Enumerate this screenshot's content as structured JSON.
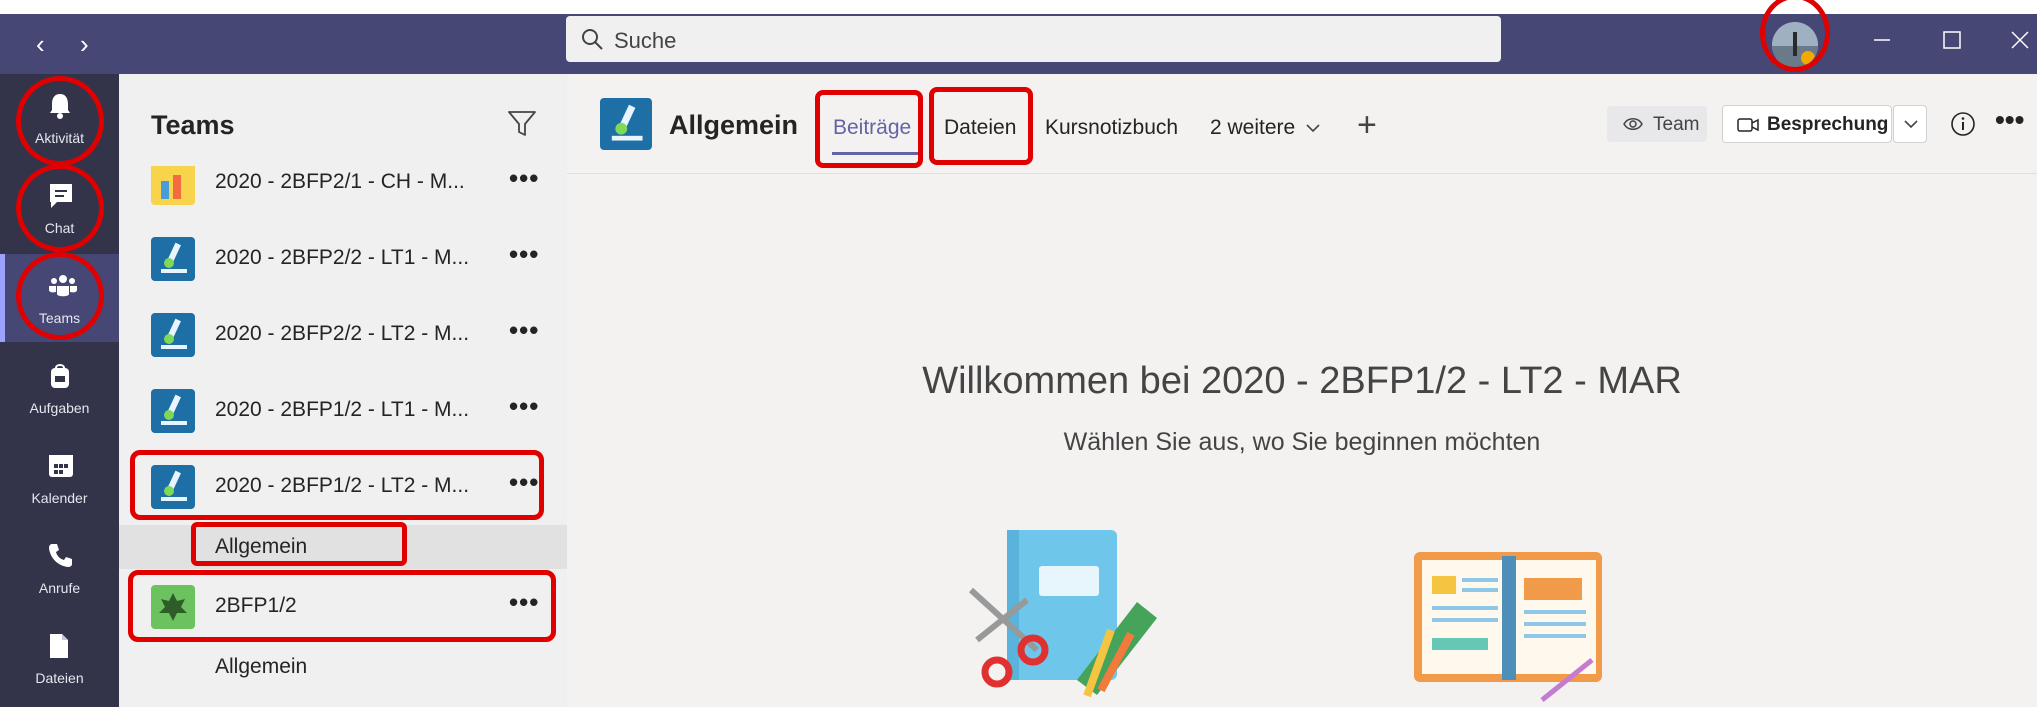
{
  "search": {
    "placeholder": "Suche"
  },
  "rail": {
    "items": [
      {
        "label": "Aktivität",
        "icon": "bell-icon"
      },
      {
        "label": "Chat",
        "icon": "chat-icon"
      },
      {
        "label": "Teams",
        "icon": "teams-icon"
      },
      {
        "label": "Aufgaben",
        "icon": "backpack-icon"
      },
      {
        "label": "Kalender",
        "icon": "calendar-icon"
      },
      {
        "label": "Anrufe",
        "icon": "phone-icon"
      },
      {
        "label": "Dateien",
        "icon": "file-icon"
      }
    ]
  },
  "teamspanel": {
    "title": "Teams",
    "teams": [
      {
        "name": "2020 - 2BFP2/1 - CH - M..."
      },
      {
        "name": "2020 - 2BFP2/2 - LT1 - M..."
      },
      {
        "name": "2020 - 2BFP2/2 - LT2 - M..."
      },
      {
        "name": "2020 - 2BFP1/2 - LT1 - M..."
      },
      {
        "name": "2020 - 2BFP1/2 - LT2 - M...",
        "channel": "Allgemein"
      },
      {
        "name": "2BFP1/2",
        "channel": "Allgemein"
      }
    ],
    "more": "•••"
  },
  "header": {
    "channel": "Allgemein",
    "tabs": [
      "Beiträge",
      "Dateien",
      "Kursnotizbuch",
      "2 weitere"
    ],
    "add": "+",
    "team_button": "Team",
    "meeting_button": "Besprechung",
    "more": "•••"
  },
  "welcome": {
    "title": "Willkommen bei 2020 - 2BFP1/2 - LT2 - MAR",
    "subtitle": "Wählen Sie aus, wo Sie beginnen möchten"
  },
  "colors": {
    "titlebar": "#464775",
    "rail": "#33344a",
    "accent": "#6264a7",
    "annotation": "#e00000"
  }
}
